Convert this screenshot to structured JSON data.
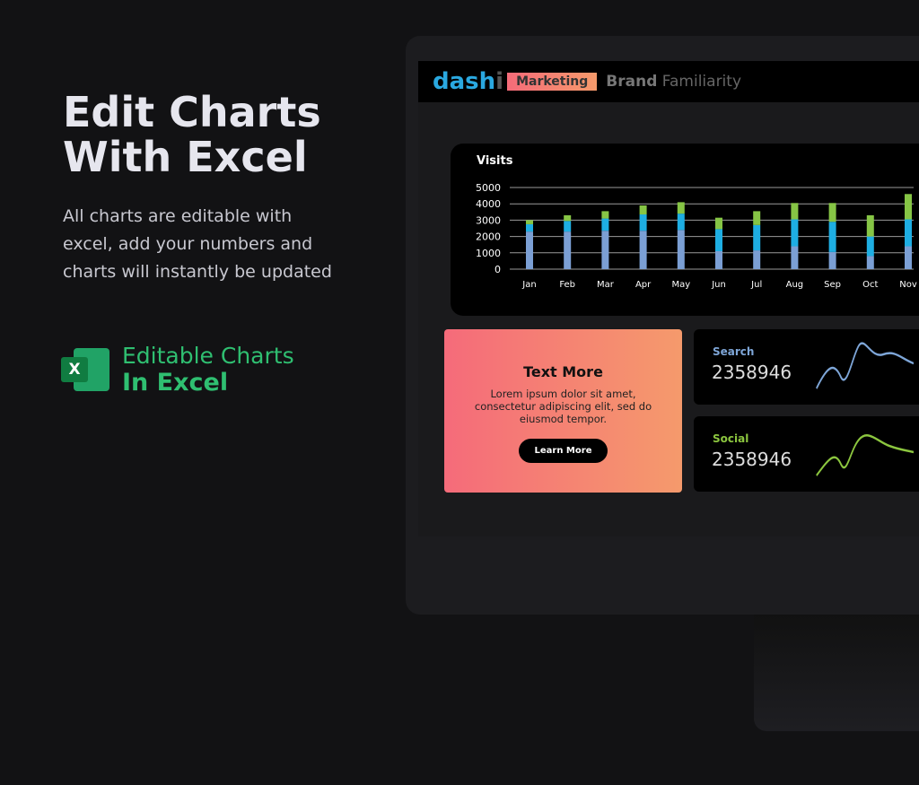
{
  "hero": {
    "title_line1": "Edit Charts",
    "title_line2": "With Excel",
    "description": "All charts are editable with excel, add your numbers and charts will instantly be updated"
  },
  "excel_badge": {
    "icon": "excel-icon",
    "letter": "X",
    "line1": "Editable Charts",
    "line2": "In Excel"
  },
  "dashboard": {
    "logo": {
      "a": "dash",
      "b": "i"
    },
    "tag": "Marketing",
    "title_bold": "Brand",
    "title_rest": "Familiarity",
    "promo": {
      "title": "Text More",
      "body": "Lorem ipsum dolor sit amet, consectetur adipiscing elit, sed do eiusmod tempor.",
      "button": "Learn More"
    },
    "stats": [
      {
        "label": "Search",
        "value": "2358946",
        "color": "#7ea6d8"
      },
      {
        "label": "Social",
        "value": "2358946",
        "color": "#8cc63f"
      }
    ]
  },
  "chart_data": {
    "type": "bar",
    "stacked": true,
    "title": "Visits",
    "categories": [
      "Jan",
      "Feb",
      "Mar",
      "Apr",
      "May",
      "Jun",
      "Jul",
      "Aug",
      "Sep",
      "Oct",
      "Nov"
    ],
    "series": [
      {
        "values": [
          2300,
          2300,
          2350,
          2350,
          2400,
          1100,
          1150,
          1400,
          1050,
          800,
          1400
        ],
        "color": "#7b9fd4"
      },
      {
        "values": [
          450,
          650,
          750,
          1000,
          1000,
          1350,
          1550,
          1650,
          1850,
          1200,
          1650
        ],
        "color": "#1eaee3"
      },
      {
        "values": [
          250,
          350,
          450,
          550,
          700,
          700,
          850,
          1000,
          1150,
          1300,
          1550
        ],
        "color": "#86c545"
      }
    ],
    "yticks": [
      0,
      1000,
      2000,
      3000,
      4000,
      5000
    ],
    "ylim": [
      0,
      5000
    ],
    "grid": true
  }
}
